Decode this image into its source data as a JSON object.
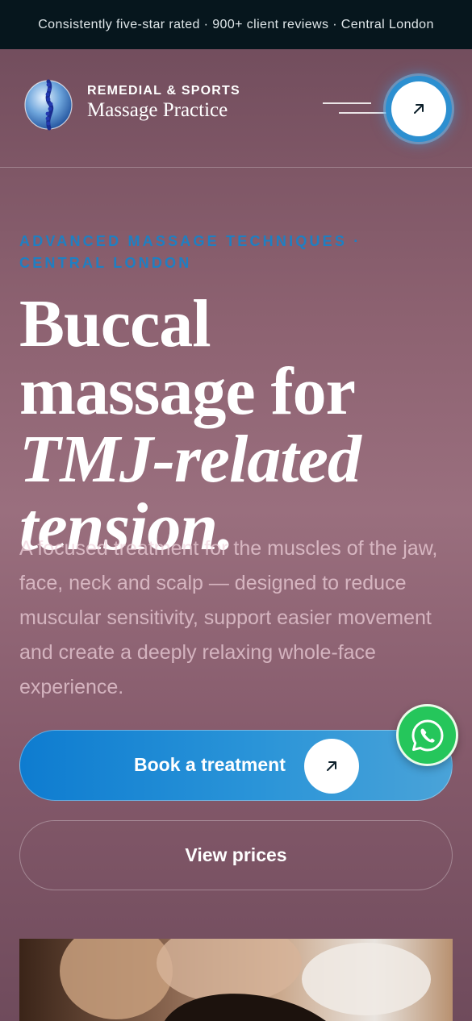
{
  "announcement": {
    "text": "Consistently five-star rated · 900+ client reviews · Central London"
  },
  "header": {
    "brand_line1": "REMEDIAL & SPORTS",
    "brand_line2": "Massage Practice"
  },
  "hero": {
    "eyebrow": "ADVANCED MASSAGE TECHNIQUES · CENTRAL LONDON",
    "headline_part1": "Buccal massage for ",
    "headline_em": "TMJ-related tension.",
    "lede": "A focused treatment for the muscles of the jaw, face, neck and scalp — designed to reduce muscular sensitivity, support easier movement and create a deeply relaxing whole-face experience."
  },
  "actions": {
    "book_label": "Book a treatment",
    "prices_label": "View prices"
  },
  "colors": {
    "accent_blue": "#1f7fc2",
    "whatsapp_green": "#25c65b",
    "topbar": "#06161d"
  },
  "icons": {
    "menu": "arrow-up-right-icon",
    "book": "arrow-up-right-icon",
    "chat": "whatsapp-icon"
  }
}
